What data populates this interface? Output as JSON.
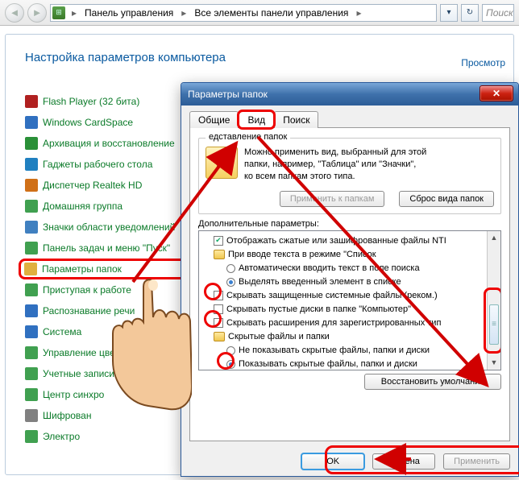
{
  "nav": {
    "breadcrumb1": "Панель управления",
    "breadcrumb2": "Все элементы панели управления",
    "search_placeholder": "Поиск"
  },
  "panel": {
    "title": "Настройка параметров компьютера",
    "view_link": "Просмотр"
  },
  "items": [
    {
      "label": "Flash Player (32 бита)",
      "color": "#b02020"
    },
    {
      "label": "Windows CardSpace",
      "color": "#3070c0"
    },
    {
      "label": "Архивация и восстановление",
      "color": "#2a9038"
    },
    {
      "label": "Гаджеты рабочего стола",
      "color": "#2080c0"
    },
    {
      "label": "Диспетчер Realtek HD",
      "color": "#d07018"
    },
    {
      "label": "Домашняя группа",
      "color": "#40a050"
    },
    {
      "label": "Значки области уведомлений",
      "color": "#4080c0"
    },
    {
      "label": "Панель задач и меню \"Пуск\"",
      "color": "#40a050"
    },
    {
      "label": "Параметры папок",
      "color": "#e0b040",
      "highlight": true
    },
    {
      "label": "Приступая к работе",
      "color": "#40a050"
    },
    {
      "label": "Распознавание речи",
      "color": "#3070c0"
    },
    {
      "label": "Система",
      "color": "#3070c0"
    },
    {
      "label": "Управление цветом",
      "color": "#40a050"
    },
    {
      "label": "Учетные записи",
      "color": "#40a050"
    },
    {
      "label": "Центр синхро",
      "color": "#40a050"
    },
    {
      "label": "Шифрован",
      "color": "#808080"
    },
    {
      "label": "Электро",
      "color": "#40a050"
    }
  ],
  "dialog": {
    "title": "Параметры папок",
    "tabs": {
      "general": "Общие",
      "view": "Вид",
      "search": "Поиск"
    },
    "group_label": "едставление папок",
    "group_text1": "Можно применить вид, выбранный для этой",
    "group_text2": "папки, например, \"Таблица\" или \"Значки\",",
    "group_text3": "ко всем папкам этого типа.",
    "btn_apply_folders": "Применить к папкам",
    "btn_reset_folders": "Сброс вида папок",
    "adv_label": "Дополнительные параметры:",
    "tree": {
      "n1": "Отображать сжатые или зашифрованные файлы NTI",
      "n2": "При вводе текста в режиме \"Список",
      "n2a": "Автоматически вводить текст в поле поиска",
      "n2b": "Выделять введенный элемент в списке",
      "n3": "Скрывать защищенные системные файлы (реком.)",
      "n4": "Скрывать пустые диски в папке \"Компьютер\"",
      "n5": "Скрывать расширения для зарегистрированных тип",
      "n6": "Скрытые файлы и папки",
      "n6a": "Не показывать скрытые файлы, папки и диски",
      "n6b": "Показывать скрытые файлы, папки и диски"
    },
    "btn_restore": "Восстановить умолчания",
    "btn_ok": "OK",
    "btn_cancel": "Отмена",
    "btn_apply": "Применить"
  }
}
